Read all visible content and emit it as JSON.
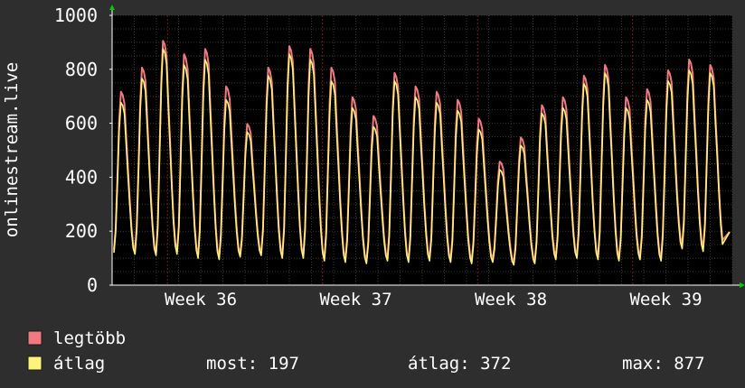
{
  "chart_data": {
    "type": "line",
    "ylabel": "onlinestream.live",
    "ylim": [
      0,
      1000
    ],
    "yticks": [
      "0",
      "200",
      "400",
      "600",
      "800",
      "1000"
    ],
    "xticks": [
      "Week 36",
      "Week 37",
      "Week 38",
      "Week 39"
    ],
    "grid": true,
    "legend_placement": "bottom-left",
    "colors": {
      "background": "#2e2e2e",
      "plot_background": "#000000",
      "grid_minor": "#3a3a3a",
      "grid_major": "#7a1c1c",
      "legtobb": "#f07a80",
      "atlag": "#fff27a"
    },
    "series": [
      {
        "name": "legtöbb",
        "color": "#f07a80",
        "peaks": [
          720,
          810,
          910,
          860,
          880,
          740,
          600,
          810,
          890,
          880,
          810,
          700,
          630,
          790,
          740,
          720,
          690,
          620,
          460,
          550,
          670,
          700,
          780,
          820,
          700,
          730,
          800,
          840,
          820
        ],
        "troughs": [
          130,
          125,
          120,
          125,
          110,
          105,
          115,
          120,
          110,
          110,
          100,
          95,
          90,
          100,
          95,
          100,
          95,
          90,
          95,
          85,
          90,
          105,
          110,
          105,
          100,
          105,
          100,
          150,
          140
        ]
      },
      {
        "name": "átlag",
        "color": "#fff27a",
        "peaks": [
          680,
          770,
          880,
          820,
          840,
          690,
          570,
          780,
          860,
          840,
          760,
          660,
          590,
          760,
          700,
          680,
          650,
          580,
          430,
          520,
          640,
          660,
          750,
          790,
          660,
          690,
          760,
          800,
          790
        ],
        "troughs": [
          120,
          115,
          110,
          115,
          100,
          95,
          105,
          110,
          100,
          100,
          90,
          85,
          80,
          90,
          85,
          90,
          85,
          80,
          85,
          75,
          80,
          95,
          100,
          95,
          90,
          95,
          90,
          135,
          125
        ]
      }
    ],
    "last_value": 197
  },
  "legend": {
    "items": [
      {
        "label": "legtöbb",
        "color": "#f07a80"
      },
      {
        "label": "átlag",
        "color": "#fff27a"
      }
    ],
    "stats": {
      "most": "most: 197",
      "atlag": "átlag: 372",
      "max": "max: 877"
    }
  }
}
